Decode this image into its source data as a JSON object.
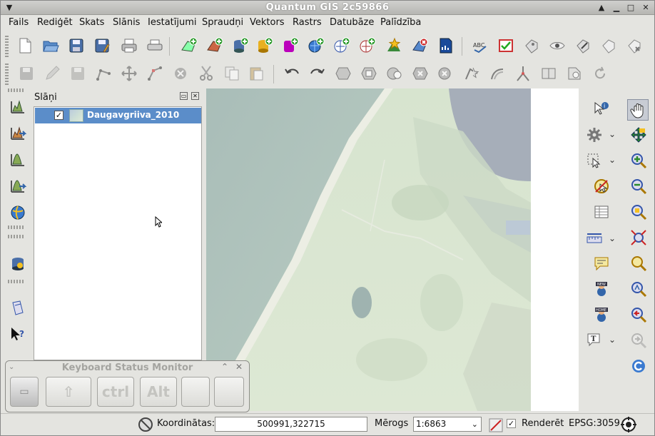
{
  "window": {
    "title": "Quantum GIS 2c59866"
  },
  "menu": [
    "Fails",
    "Rediģēt",
    "Skats",
    "Slānis",
    "Iestatījumi",
    "Spraudņi",
    "Vektors",
    "Rastrs",
    "Datubāze",
    "Palīdzība"
  ],
  "layers_panel": {
    "title": "Slāņi",
    "layers": [
      {
        "name": "Daugavgriiva_2010",
        "checked": "✓"
      }
    ]
  },
  "keyboard_monitor": {
    "title": "Keyboard Status Monitor",
    "keys": {
      "shift": "⇧",
      "ctrl": "ctrl",
      "alt": "Alt"
    }
  },
  "statusbar": {
    "coords_label": "Koordinātas:",
    "coords_value": "500991,322715",
    "scale_label": "Mērogs",
    "scale_value": "1:6863",
    "render_label": "Renderēt",
    "render_checked": "✓",
    "crs": "EPSG:3059"
  },
  "colors": {
    "selection": "#5b8dc9",
    "titlebar_text": "#ffffff",
    "water": "#a9bdb8",
    "land": "#dde8d4"
  }
}
